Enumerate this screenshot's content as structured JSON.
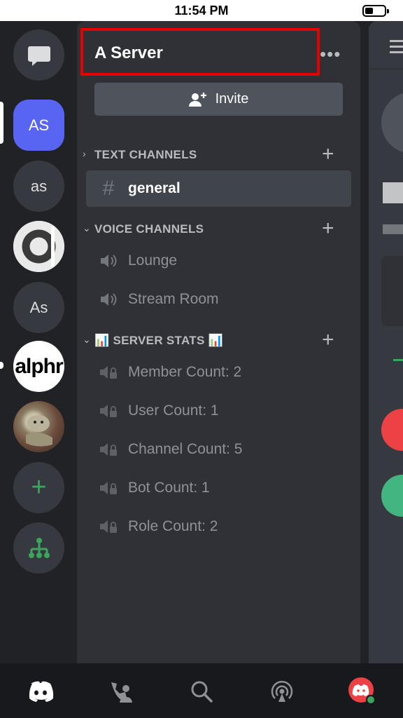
{
  "status_bar": {
    "time": "11:54 PM"
  },
  "servers": [
    {
      "label": "AS",
      "active": true
    },
    {
      "label": "as"
    },
    {
      "label": ""
    },
    {
      "label": "As"
    },
    {
      "label": "alphr"
    },
    {
      "label": ""
    }
  ],
  "rail_actions": {
    "add_server": "+",
    "explore": "explore-icon"
  },
  "server": {
    "name": "A Server",
    "more_label": "•••"
  },
  "invite": {
    "label": "Invite"
  },
  "categories": [
    {
      "label": "TEXT CHANNELS"
    },
    {
      "label": "VOICE CHANNELS"
    },
    {
      "label": "📊 SERVER STATS 📊"
    }
  ],
  "text_channels": [
    {
      "name": "general",
      "selected": true
    }
  ],
  "voice_channels": [
    {
      "name": "Lounge"
    },
    {
      "name": "Stream Room"
    }
  ],
  "stats_channels": [
    {
      "name": "Member Count: 2"
    },
    {
      "name": "User Count: 1"
    },
    {
      "name": "Channel Count: 5"
    },
    {
      "name": "Bot Count: 1"
    },
    {
      "name": "Role Count: 2"
    }
  ],
  "tabs": [
    "home-icon",
    "friends-icon",
    "search-icon",
    "mentions-icon",
    "profile-icon"
  ],
  "colors": {
    "accent": "#5865f2",
    "highlight": "#e60000",
    "online": "#3ba55d"
  }
}
